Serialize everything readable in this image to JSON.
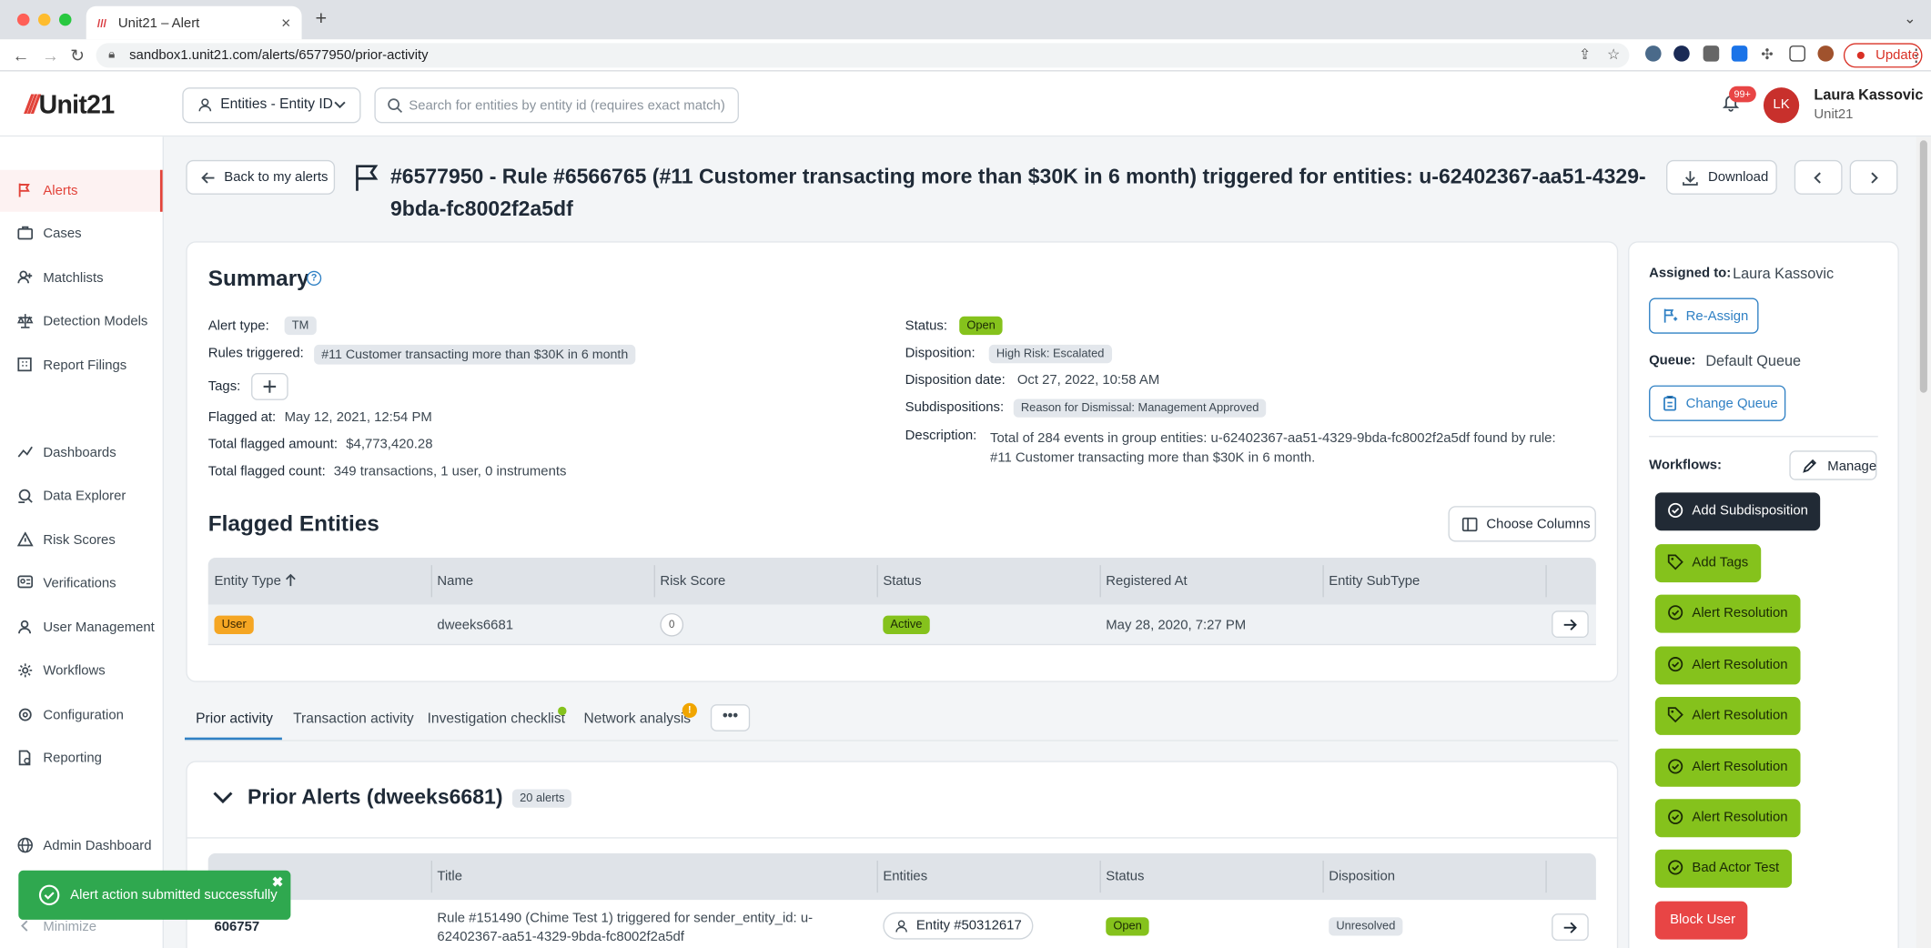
{
  "browser": {
    "tab_title": "Unit21 – Alert",
    "url": "sandbox1.unit21.com/alerts/6577950/prior-activity",
    "update_label": "Update",
    "favicon": "///"
  },
  "header": {
    "logo": "Unit21",
    "logo_mark": "///",
    "entity_select": "Entities - Entity ID",
    "search_placeholder": "Search for entities by entity id (requires exact match)",
    "notif_count": "99+",
    "avatar_initials": "LK",
    "user_name": "Laura Kassovic",
    "user_org": "Unit21"
  },
  "sidebar": {
    "items": [
      {
        "label": "Alerts",
        "icon": "flag-icon"
      },
      {
        "label": "Cases",
        "icon": "briefcase-icon"
      },
      {
        "label": "Matchlists",
        "icon": "user-plus-icon"
      },
      {
        "label": "Detection Models",
        "icon": "scale-icon"
      },
      {
        "label": "Report Filings",
        "icon": "building-icon"
      },
      {
        "label": "Dashboards",
        "icon": "chart-line-icon"
      },
      {
        "label": "Data Explorer",
        "icon": "search-data-icon"
      },
      {
        "label": "Risk Scores",
        "icon": "warning-icon"
      },
      {
        "label": "Verifications",
        "icon": "id-card-icon"
      },
      {
        "label": "User Management",
        "icon": "user-icon"
      },
      {
        "label": "Workflows",
        "icon": "workflow-icon"
      },
      {
        "label": "Configuration",
        "icon": "gear-icon"
      },
      {
        "label": "Reporting",
        "icon": "report-icon"
      },
      {
        "label": "Admin Dashboard",
        "icon": "globe-icon"
      },
      {
        "label": "Minimize",
        "icon": "minimize-icon"
      }
    ]
  },
  "page": {
    "back_label": "Back to my alerts",
    "title": "#6577950 - Rule #6566765 (#11 Customer transacting more than $30K in 6 month) triggered for entities: u-62402367-aa51-4329-9bda-fc8002f2a5df",
    "download_label": "Download"
  },
  "summary": {
    "title": "Summary",
    "alert_type_label": "Alert type:",
    "alert_type": "TM",
    "rules_label": "Rules triggered:",
    "rules": "#11 Customer transacting more than $30K in 6 month",
    "tags_label": "Tags:",
    "flagged_at_label": "Flagged at:",
    "flagged_at": "May 12, 2021, 12:54 PM",
    "total_amount_label": "Total flagged amount:",
    "total_amount": "$4,773,420.28",
    "total_count_label": "Total flagged count:",
    "total_count": "349 transactions, 1 user, 0 instruments",
    "status_label": "Status:",
    "status": "Open",
    "disposition_label": "Disposition:",
    "disposition": "High Risk: Escalated",
    "disposition_date_label": "Disposition date:",
    "disposition_date": "Oct 27, 2022, 10:58 AM",
    "subdispositions_label": "Subdispositions:",
    "subdispositions": "Reason for Dismissal: Management Approved",
    "description_label": "Description:",
    "description": "Total of 284 events in group entities: u-62402367-aa51-4329-9bda-fc8002f2a5df found by rule: #11 Customer transacting more than $30K in 6 month."
  },
  "flagged": {
    "title": "Flagged Entities",
    "choose_columns": "Choose Columns",
    "columns": [
      "Entity Type",
      "Name",
      "Risk Score",
      "Status",
      "Registered At",
      "Entity SubType"
    ],
    "rows": [
      {
        "type": "User",
        "name": "dweeks6681",
        "risk": "0",
        "status": "Active",
        "registered": "May 28, 2020, 7:27 PM",
        "subtype": ""
      }
    ]
  },
  "tabs": [
    "Prior activity",
    "Transaction activity",
    "Investigation checklist",
    "Network analysis"
  ],
  "tab_more": "•••",
  "tab_alert_mark": "!",
  "prior": {
    "title": "Prior Alerts (dweeks6681)",
    "count": "20 alerts",
    "columns": [
      "",
      "Title",
      "Entities",
      "Status",
      "Disposition"
    ],
    "rows": [
      {
        "id": "606757",
        "title": "Rule #151490 (Chime Test 1) triggered for sender_entity_id: u-62402367-aa51-4329-9bda-fc8002f2a5df",
        "entity": "Entity #50312617",
        "status": "Open",
        "disposition": "Unresolved"
      }
    ]
  },
  "right": {
    "assigned_label": "Assigned to:",
    "assigned": "Laura Kassovic",
    "reassign": "Re-Assign",
    "queue_label": "Queue:",
    "queue": "Default Queue",
    "change_queue": "Change Queue",
    "workflows_label": "Workflows:",
    "manage": "Manage",
    "workflows": [
      {
        "label": "Add Subdisposition",
        "style": "dark",
        "icon": "check-circle-icon"
      },
      {
        "label": "Add Tags",
        "style": "green",
        "icon": "tag-icon"
      },
      {
        "label": "Alert Resolution",
        "style": "green",
        "icon": "check-circle-icon"
      },
      {
        "label": "Alert Resolution",
        "style": "green",
        "icon": "check-circle-icon"
      },
      {
        "label": "Alert Resolution",
        "style": "green",
        "icon": "tag-icon"
      },
      {
        "label": "Alert Resolution",
        "style": "green",
        "icon": "check-circle-icon"
      },
      {
        "label": "Alert Resolution",
        "style": "green",
        "icon": "check-circle-icon"
      },
      {
        "label": "Bad Actor Test",
        "style": "green",
        "icon": "check-circle-icon"
      },
      {
        "label": "Block User",
        "style": "red",
        "icon": ""
      }
    ]
  },
  "toast": {
    "message": "Alert action submitted successfully",
    "close": "✖"
  },
  "colors": {
    "accent": "#2f80c4",
    "brand": "#e2433a",
    "success": "#85c21c",
    "toast": "#2fa84f",
    "danger": "#e84545"
  }
}
